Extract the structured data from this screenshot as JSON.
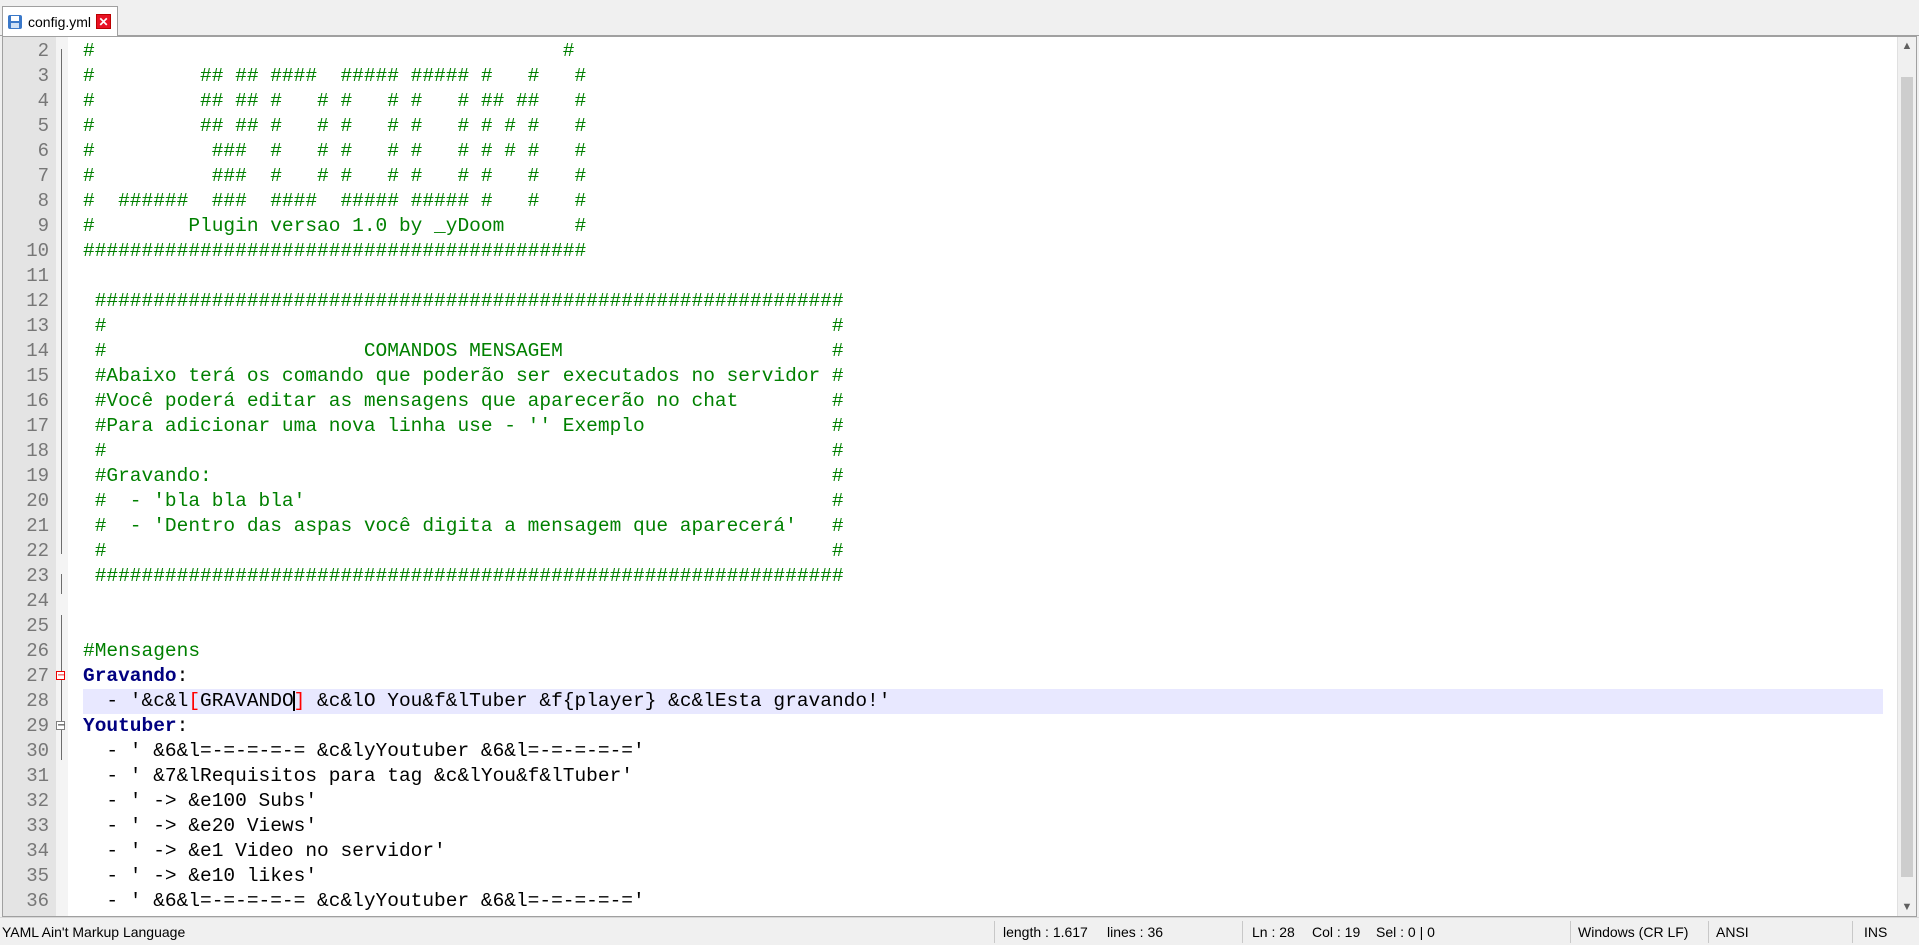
{
  "tab": {
    "title": "config.yml",
    "close_symbol": "✕"
  },
  "status": {
    "language": "YAML Ain't Markup Language",
    "length": "length : 1.617",
    "lines": "lines : 36",
    "ln": "Ln : 28",
    "col": "Col : 19",
    "sel": "Sel : 0 | 0",
    "eol": "Windows (CR LF)",
    "encoding": "ANSI",
    "mode": "INS"
  },
  "editor": {
    "current_line": "28",
    "lines": [
      {
        "n": "2",
        "text": "#                                        #"
      },
      {
        "n": "3",
        "text": "#         ## ## ####  ##### ##### #   #   #"
      },
      {
        "n": "4",
        "text": "#         ## ## #   # #   # #   # ## ##   #"
      },
      {
        "n": "5",
        "text": "#         ## ## #   # #   # #   # # # #   #"
      },
      {
        "n": "6",
        "text": "#          ###  #   # #   # #   # # # #   #"
      },
      {
        "n": "7",
        "text": "#          ###  #   # #   # #   # #   #   #"
      },
      {
        "n": "8",
        "text": "#  ######  ###  ####  ##### ##### #   #   #"
      },
      {
        "n": "9",
        "text": "#        Plugin versao 1.0 by _yDoom      #"
      },
      {
        "n": "10",
        "text": "###########################################"
      },
      {
        "n": "11",
        "text": ""
      },
      {
        "n": "12",
        "text": " ################################################################"
      },
      {
        "n": "13",
        "text": " #                                                              #"
      },
      {
        "n": "14",
        "text": " #                      COMANDOS MENSAGEM                       #"
      },
      {
        "n": "15",
        "text": " #Abaixo terá os comando que poderão ser executados no servidor #"
      },
      {
        "n": "16",
        "text": " #Você poderá editar as mensagens que aparecerão no chat        #"
      },
      {
        "n": "17",
        "text": " #Para adicionar uma nova linha use - '' Exemplo                #"
      },
      {
        "n": "18",
        "text": " #                                                              #"
      },
      {
        "n": "19",
        "text": " #Gravando:                                                     #"
      },
      {
        "n": "20",
        "text": " #  - 'bla bla bla'                                             #"
      },
      {
        "n": "21",
        "text": " #  - 'Dentro das aspas você digita a mensagem que aparecerá'   #"
      },
      {
        "n": "22",
        "text": " #                                                              #"
      },
      {
        "n": "23",
        "text": " ################################################################"
      },
      {
        "n": "24",
        "text": ""
      },
      {
        "n": "25",
        "text": ""
      },
      {
        "n": "26",
        "text": "#Mensagens"
      },
      {
        "n": "27",
        "key": "Gravando",
        "colon": ":"
      },
      {
        "n": "28",
        "pre": "  - '&c&l",
        "bopen": "[",
        "mid": "GRAVANDO",
        "bclose": "]",
        "post": " &c&lO You&f&lTuber &f{player} &c&lEsta gravando!'"
      },
      {
        "n": "29",
        "key": "Youtuber",
        "colon": ":"
      },
      {
        "n": "30",
        "text": "  - ' &6&l=-=-=-=-= &c&lyYoutuber &6&l=-=-=-=-='"
      },
      {
        "n": "31",
        "text": "  - ' &7&lRequisitos para tag &c&lYou&f&lTuber'"
      },
      {
        "n": "32",
        "text": "  - ' -> &e100 Subs'"
      },
      {
        "n": "33",
        "text": "  - ' -> &e20 Views'"
      },
      {
        "n": "34",
        "text": "  - ' -> &e1 Video no servidor'"
      },
      {
        "n": "35",
        "text": "  - ' -> &e10 likes'"
      },
      {
        "n": "36",
        "text": "  - ' &6&l=-=-=-=-= &c&lyYoutuber &6&l=-=-=-=-='"
      }
    ]
  },
  "fold_markers": {
    "collapse_symbol": "−"
  },
  "scroll": {
    "up_symbol": "▲",
    "down_symbol": "▼"
  }
}
